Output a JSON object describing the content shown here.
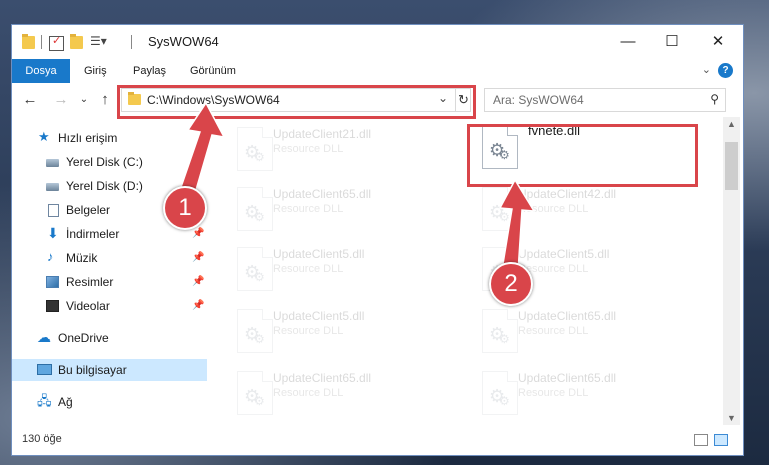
{
  "window": {
    "title": "SysWOW64"
  },
  "ribbon": {
    "tabs": [
      "Dosya",
      "Giriş",
      "Paylaş",
      "Görünüm"
    ]
  },
  "address": {
    "path": "C:\\Windows\\SysWOW64"
  },
  "search": {
    "placeholder": "Ara: SysWOW64"
  },
  "sidebar": {
    "items": [
      {
        "label": "Hızlı erişim"
      },
      {
        "label": "Yerel Disk (C:)"
      },
      {
        "label": "Yerel Disk (D:)"
      },
      {
        "label": "Belgeler"
      },
      {
        "label": "İndirmeler"
      },
      {
        "label": "Müzik"
      },
      {
        "label": "Resimler"
      },
      {
        "label": "Videolar"
      },
      {
        "label": "OneDrive"
      },
      {
        "label": "Bu bilgisayar"
      },
      {
        "label": "Ağ"
      }
    ]
  },
  "files": {
    "left": [
      {
        "name": "UpdateClient21.dll",
        "type": "Resource DLL"
      },
      {
        "name": "UpdateClient65.dll",
        "type": "Resource DLL"
      },
      {
        "name": "UpdateClient5.dll",
        "type": "Resource DLL"
      },
      {
        "name": "UpdateClient5.dll",
        "type": "Resource DLL"
      },
      {
        "name": "UpdateClient65.dll",
        "type": "Resource DLL"
      }
    ],
    "right": [
      {
        "name": "fvnete.dll",
        "type": ""
      },
      {
        "name": "UpdateClient42.dll",
        "type": "Resource DLL"
      },
      {
        "name": "UpdateClient5.dll",
        "type": "Resource DLL"
      },
      {
        "name": "UpdateClient65.dll",
        "type": "Resource DLL"
      },
      {
        "name": "UpdateClient65.dll",
        "type": "Resource DLL"
      }
    ]
  },
  "status": {
    "count": "130 öğe"
  },
  "annotations": {
    "step1": "1",
    "step2": "2"
  },
  "colors": {
    "accent": "#1979ca",
    "highlight": "#d9454a",
    "selection": "#cce8ff"
  }
}
